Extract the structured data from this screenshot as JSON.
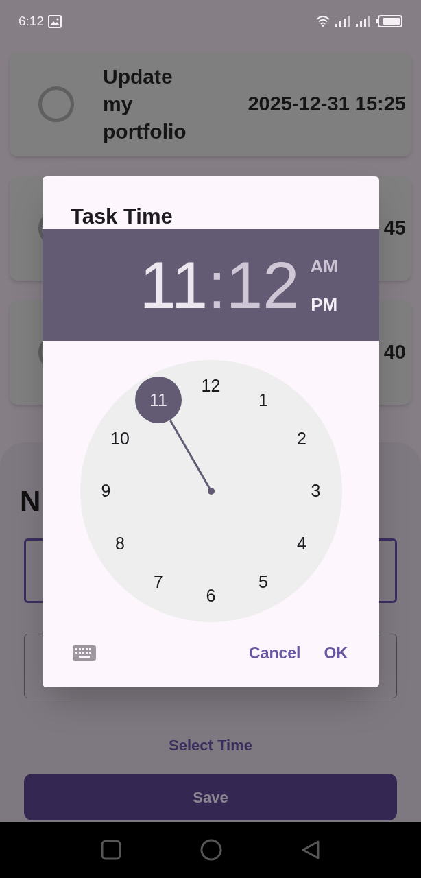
{
  "status_bar": {
    "time": "6:12"
  },
  "tasks": [
    {
      "title": "Update my portfolio",
      "due": "2025-12-31 15:25",
      "checked": false
    },
    {
      "due": "45",
      "checked": false
    },
    {
      "due": "40",
      "checked": false
    }
  ],
  "sheet": {
    "heading": "N",
    "fields": [
      {
        "focused": true
      },
      {
        "focused": false
      }
    ],
    "select_time": "Select Time",
    "save": "Save"
  },
  "dialog": {
    "title": "Task Time",
    "hour": "11",
    "separator": ":",
    "minute": "12",
    "hour_selected": true,
    "periods": [
      {
        "label": "AM",
        "selected": false
      },
      {
        "label": "PM",
        "selected": true
      }
    ],
    "dial": [
      {
        "label": "12",
        "selected": false
      },
      {
        "label": "1",
        "selected": false
      },
      {
        "label": "2",
        "selected": false
      },
      {
        "label": "3",
        "selected": false
      },
      {
        "label": "4",
        "selected": false
      },
      {
        "label": "5",
        "selected": false
      },
      {
        "label": "6",
        "selected": false
      },
      {
        "label": "7",
        "selected": false
      },
      {
        "label": "8",
        "selected": false
      },
      {
        "label": "9",
        "selected": false
      },
      {
        "label": "10",
        "selected": false
      },
      {
        "label": "11",
        "selected": true
      }
    ],
    "buttons": [
      "Cancel",
      "OK"
    ]
  }
}
